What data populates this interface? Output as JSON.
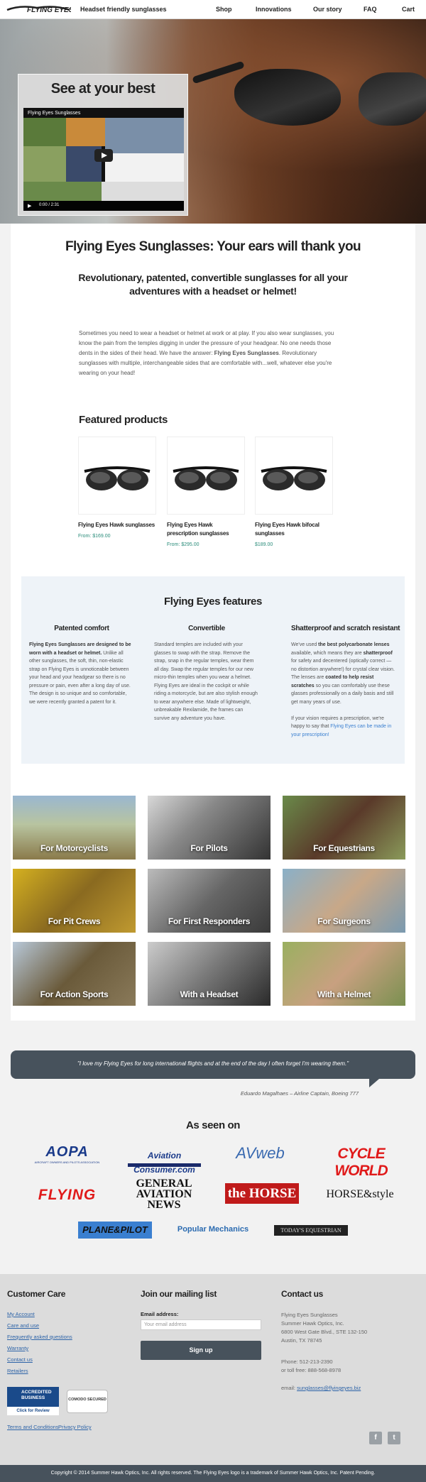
{
  "header": {
    "logo_text": "FLYING EYES",
    "tagline": "Headset friendly sunglasses",
    "nav": [
      "Shop",
      "Innovations",
      "Our story",
      "FAQ",
      "Cart"
    ]
  },
  "hero": {
    "title": "See at your best",
    "video_title": "Flying Eyes Sunglasses",
    "video_time": "0:00 / 2:31"
  },
  "main": {
    "h1": "Flying Eyes Sunglasses: Your ears will thank you",
    "h2": "Revolutionary, patented, convertible sunglasses for all your adventures with a headset or helmet!",
    "intro_1": "Sometimes you need to wear a headset or helmet at work or at play. If you also wear sunglasses, you know the pain from the temples digging in under the pressure of your headgear. No one needs those dents in the sides of their head. We have the answer: ",
    "intro_bold": "Flying Eyes Sunglasses",
    "intro_2": ". Revolutionary sunglasses with multiple, interchangeable sides that are comfortable with...well, whatever else you're wearing on your head!"
  },
  "featured": {
    "title": "Featured products",
    "products": [
      {
        "name": "Flying Eyes Hawk sunglasses",
        "price": "From: $169.00"
      },
      {
        "name": "Flying Eyes Hawk prescription sunglasses",
        "price": "From: $295.00"
      },
      {
        "name": "Flying Eyes Hawk bifocal sunglasses",
        "price": "$189.00"
      }
    ]
  },
  "features": {
    "title": "Flying Eyes features",
    "col1": {
      "heading": "Patented comfort",
      "bold": "Flying Eyes Sunglasses are designed to be worn with a headset or helmet.",
      "text": " Unlike all other sunglasses, the soft, thin, non-elastic strap on Flying Eyes is unnoticeable between your head and your headgear so there is no pressure or pain, even after a long day of use. The design is so unique and so comfortable, we were recently granted a patent for it."
    },
    "col2": {
      "heading": "Convertible",
      "text": "Standard temples are included with your glasses to swap with the strap. Remove the strap, snap in the regular temples, wear them all day. Swap the regular temples for our new micro-thin temples when you wear a helmet. Flying Eyes are ideal in the cockpit or while riding a motorcycle, but are also stylish enough to wear anywhere else. Made of lightweight, unbreakable Rexilamide, the frames can survive any adventure you have."
    },
    "col3": {
      "heading": "Shatterproof and scratch resistant",
      "t1": "We've used ",
      "b1": "the best polycarbonate lenses",
      "t2": " available, which means they are ",
      "b2": "shatterproof",
      "t3": " for safety and decentered (optically correct — no distortion anywhere!) for crystal clear vision. The lenses are ",
      "b3": "coated to help resist scratches",
      "t4": " so you can comfortably use these glasses professionally on a daily basis and still get many years of use.",
      "t5": "If your vision requires a prescription, we're happy to say that ",
      "link": "Flying Eyes can be made in your prescription!"
    }
  },
  "categories": [
    "For Motorcyclists",
    "For Pilots",
    "For Equestrians",
    "For Pit Crews",
    "For First Responders",
    "For Surgeons",
    "For Action Sports",
    "With a Headset",
    "With a Helmet"
  ],
  "testimonial": {
    "quote": "\"I love my Flying Eyes for long international flights and at the end of the day I often forget I'm wearing them.\"",
    "cite": "Eduardo Magalhaes – Airline Captain, Boeing 777"
  },
  "media": {
    "title": "As seen on",
    "logos": [
      "AOPA",
      "Aviation Consumer.com",
      "AVweb",
      "CYCLE WORLD",
      "FLYING",
      "GENERAL AVIATION NEWS",
      "the HORSE",
      "HORSE&style",
      "PLANE&PILOT",
      "Popular Mechanics",
      "TODAY'S EQUESTRIAN"
    ],
    "aopa_sub": "AIRCRAFT OWNERS AND PILOTS ASSOCIATION"
  },
  "footer": {
    "care_title": "Customer Care",
    "care_links": [
      "My Account",
      "Care and use",
      "Frequently asked questions",
      "Warranty",
      "Contact us",
      "Retailers"
    ],
    "mail_title": "Join our mailing list",
    "email_label": "Email address:",
    "email_placeholder": "Your email address",
    "signup": "Sign up",
    "contact_title": "Contact us",
    "address": [
      "Flying Eyes Sunglasses",
      "Summer Hawk Optics, Inc.",
      "6800 West Gate Blvd., STE 132-150",
      "Austin, TX 78745"
    ],
    "phone": "Phone: 512-213-2390",
    "tollfree": "or toll free: 888-568-8978",
    "email_prefix": "email: ",
    "email": "sunglasses@flyingeyes.biz",
    "bbb_line1": "ACCREDITED",
    "bbb_line2": "BUSINESS",
    "bbb_review": "Click for Review",
    "comodo": "COMODO SECURED",
    "terms": "Terms and Conditions",
    "privacy": "Privacy Policy",
    "copyright": "Copyright © 2014 Summer Hawk Optics, Inc. All rights reserved. The Flying Eyes logo is a trademark of Summer Hawk Optics, Inc. Patent Pending."
  }
}
